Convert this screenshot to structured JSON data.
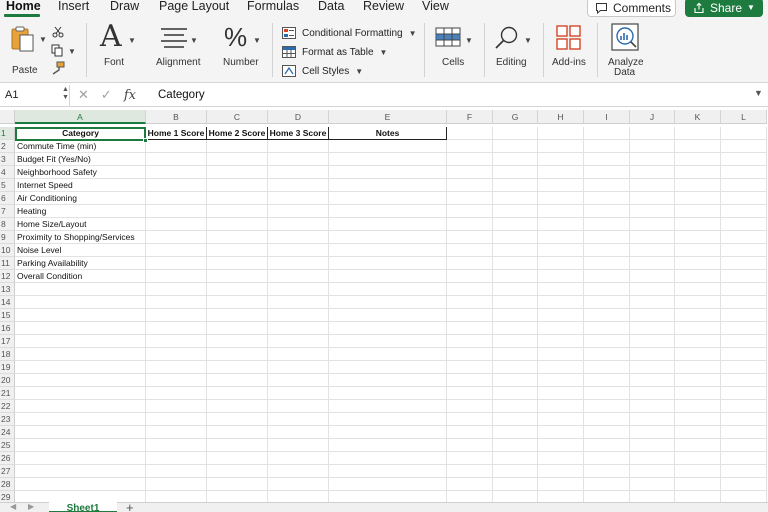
{
  "menu": {
    "tabs": [
      "Home",
      "Insert",
      "Draw",
      "Page Layout",
      "Formulas",
      "Data",
      "Review",
      "View"
    ],
    "active": "Home",
    "comments_label": "Comments",
    "share_label": "Share"
  },
  "ribbon": {
    "paste": "Paste",
    "font": "Font",
    "alignment": "Alignment",
    "number": "Number",
    "conditional_formatting": "Conditional Formatting",
    "format_as_table": "Format as Table",
    "cell_styles": "Cell Styles",
    "cells": "Cells",
    "editing": "Editing",
    "addins": "Add-ins",
    "analyze_data_line1": "Analyze",
    "analyze_data_line2": "Data"
  },
  "formula_bar": {
    "name_box": "A1",
    "fx_label": "fx",
    "content": "Category"
  },
  "grid": {
    "columns": [
      "A",
      "B",
      "C",
      "D",
      "E",
      "F",
      "G",
      "H",
      "I",
      "J",
      "K",
      "L"
    ],
    "selected_column": "A",
    "selected_row": 1,
    "row_count": 29,
    "header_row": [
      "Category",
      "Home 1 Score",
      "Home 2 Score",
      "Home 3 Score",
      "Notes"
    ],
    "categories": [
      "Commute Time (min)",
      "Budget Fit (Yes/No)",
      "Neighborhood Safety",
      "Internet Speed",
      "Air Conditioning",
      "Heating",
      "Home Size/Layout",
      "Proximity to Shopping/Services",
      "Noise Level",
      "Parking Availability",
      "Overall Condition"
    ]
  },
  "sheets": {
    "tabs": [
      "Sheet1"
    ],
    "add_label": "+"
  },
  "colors": {
    "accent": "#1e7b3f",
    "icon_red": "#d24726",
    "icon_blue": "#2b6cb0"
  }
}
